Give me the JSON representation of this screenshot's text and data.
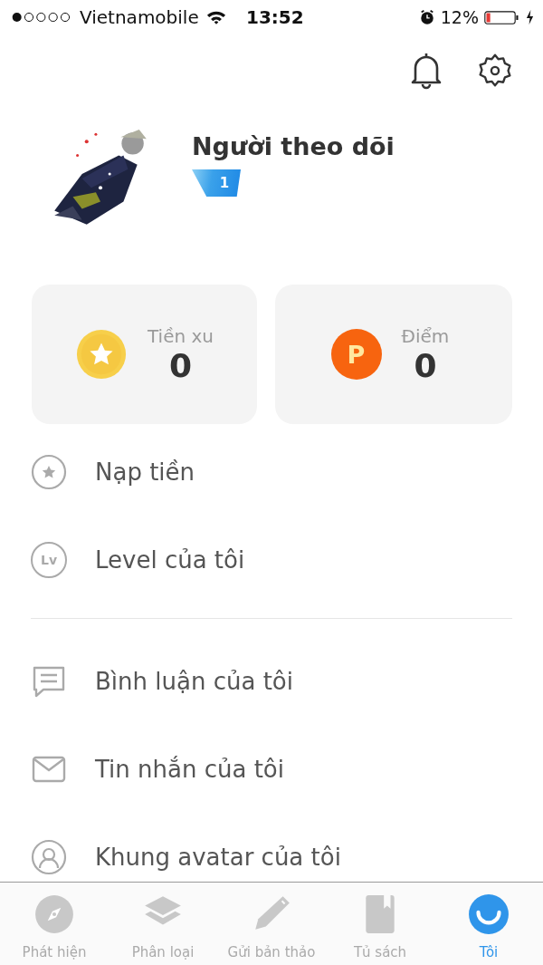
{
  "status_bar": {
    "carrier": "Vietnamobile",
    "time": "13:52",
    "battery": "12%"
  },
  "header": {
    "buttons": [
      {
        "kind": "bell"
      },
      {
        "kind": "gear"
      }
    ]
  },
  "profile": {
    "name": "Người theo dõi",
    "level_badge": "1"
  },
  "wallet": [
    {
      "kind": "coin",
      "label": "Tiền xu",
      "value": "0"
    },
    {
      "kind": "points",
      "label": "Điểm",
      "value": "0",
      "icon_text": "P"
    }
  ],
  "menu_groups": [
    [
      {
        "kind": "coin",
        "label": "Nạp tiền"
      },
      {
        "kind": "level",
        "label": "Level của tôi",
        "icon_text": "Lv"
      }
    ],
    [
      {
        "kind": "comment",
        "label": "Bình luận của tôi"
      },
      {
        "kind": "mail",
        "label": "Tin nhắn của tôi"
      },
      {
        "kind": "frame",
        "label": "Khung avatar của tôi"
      }
    ]
  ],
  "tab_bar": [
    {
      "kind": "compass",
      "label": "Phát hiện",
      "selected": false
    },
    {
      "kind": "layers",
      "label": "Phân loại",
      "selected": false
    },
    {
      "kind": "pencil",
      "label": "Gửi bản thảo",
      "selected": false
    },
    {
      "kind": "book",
      "label": "Tủ sách",
      "selected": false
    },
    {
      "kind": "smile",
      "label": "Tôi",
      "selected": true
    }
  ]
}
